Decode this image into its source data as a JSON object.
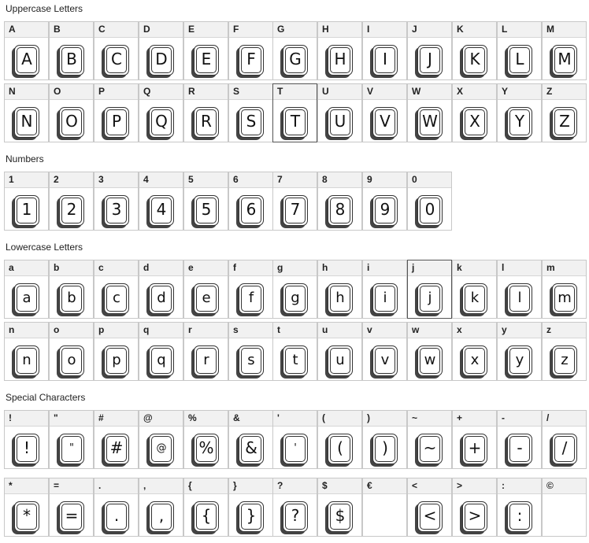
{
  "sections": [
    {
      "title": "Uppercase Letters",
      "rows": [
        [
          "A",
          "B",
          "C",
          "D",
          "E",
          "F",
          "G",
          "H",
          "I",
          "J",
          "K",
          "L",
          "M"
        ],
        [
          "N",
          "O",
          "P",
          "Q",
          "R",
          "S",
          "T",
          "U",
          "V",
          "W",
          "X",
          "Y",
          "Z"
        ]
      ]
    },
    {
      "title": "Numbers",
      "rows": [
        [
          "1",
          "2",
          "3",
          "4",
          "5",
          "6",
          "7",
          "8",
          "9",
          "0"
        ]
      ]
    },
    {
      "title": "Lowercase Letters",
      "rows": [
        [
          "a",
          "b",
          "c",
          "d",
          "e",
          "f",
          "g",
          "h",
          "i",
          "j",
          "k",
          "l",
          "m"
        ],
        [
          "n",
          "o",
          "p",
          "q",
          "r",
          "s",
          "t",
          "u",
          "v",
          "w",
          "x",
          "y",
          "z"
        ]
      ]
    },
    {
      "title": "Special Characters",
      "rows": [
        [
          "!",
          "\"",
          "#",
          "@",
          "%",
          "&",
          "'",
          "(",
          ")",
          "~",
          "+",
          "-",
          "/"
        ],
        [
          "*",
          "=",
          ".",
          ",",
          "{",
          "}",
          "?",
          "$",
          "€",
          "<",
          ">",
          ":",
          "©"
        ]
      ]
    }
  ],
  "missing_glyphs": [
    "€",
    "©"
  ],
  "selected_cells": [
    "T",
    "j"
  ]
}
